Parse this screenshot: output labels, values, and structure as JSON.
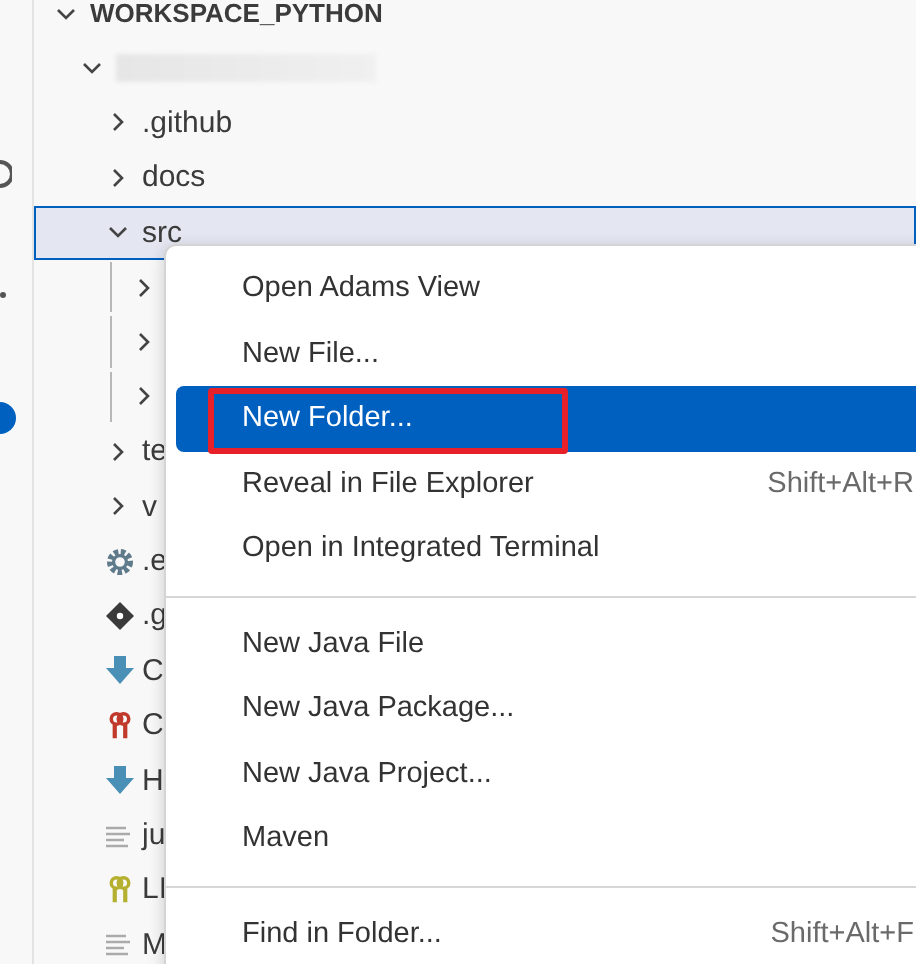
{
  "explorer": {
    "tree": [
      {
        "label": "WORKSPACE_PYTHON",
        "kind": "root",
        "expanded": true,
        "selected": false,
        "children": [
          {
            "kind": "redacted",
            "expanded": true,
            "selected": false,
            "children": [
              {
                "label": ".github",
                "kind": "folder",
                "expanded": false,
                "selected": false
              },
              {
                "label": "docs",
                "kind": "folder",
                "expanded": false,
                "selected": false
              },
              {
                "label": "src",
                "kind": "folder",
                "expanded": true,
                "selected": true,
                "children": [
                  {
                    "kind": "folder",
                    "expanded": false,
                    "selected": false
                  },
                  {
                    "kind": "folder",
                    "expanded": false,
                    "selected": false
                  },
                  {
                    "kind": "folder",
                    "expanded": false,
                    "selected": false
                  }
                ]
              },
              {
                "label": "te",
                "kind": "folder",
                "expanded": false,
                "selected": false
              },
              {
                "label": "v",
                "kind": "folder",
                "expanded": false,
                "selected": false
              },
              {
                "label": ".e",
                "kind": "config",
                "selected": false
              },
              {
                "label": ".g",
                "kind": "git",
                "selected": false
              },
              {
                "label": "C",
                "kind": "download",
                "selected": false
              },
              {
                "label": "C",
                "kind": "license",
                "color": "#c0392b",
                "selected": false
              },
              {
                "label": "H",
                "kind": "download",
                "selected": false
              },
              {
                "label": "ju",
                "kind": "text",
                "selected": false
              },
              {
                "label": "LI",
                "kind": "license",
                "color": "#b5b030",
                "selected": false
              },
              {
                "label": "M",
                "kind": "text",
                "selected": false
              }
            ]
          }
        ]
      }
    ]
  },
  "context_menu": {
    "groups": [
      [
        {
          "label": "Open Adams View",
          "selected": false,
          "annotated": false
        },
        {
          "label": "New File...",
          "selected": false,
          "annotated": false
        },
        {
          "label": "New Folder...",
          "selected": true,
          "annotated": true
        },
        {
          "label": "Reveal in File Explorer",
          "shortcut": "Shift+Alt+R",
          "selected": false,
          "annotated": false
        },
        {
          "label": "Open in Integrated Terminal",
          "selected": false,
          "annotated": false
        }
      ],
      [
        {
          "label": "New Java File",
          "selected": false,
          "annotated": false
        },
        {
          "label": "New Java Package...",
          "selected": false,
          "annotated": false
        },
        {
          "label": "New Java Project...",
          "selected": false,
          "annotated": false
        },
        {
          "label": "Maven",
          "selected": false,
          "annotated": false
        }
      ],
      [
        {
          "label": "Find in Folder...",
          "shortcut": "Shift+Alt+F",
          "selected": false,
          "annotated": false
        }
      ]
    ]
  }
}
